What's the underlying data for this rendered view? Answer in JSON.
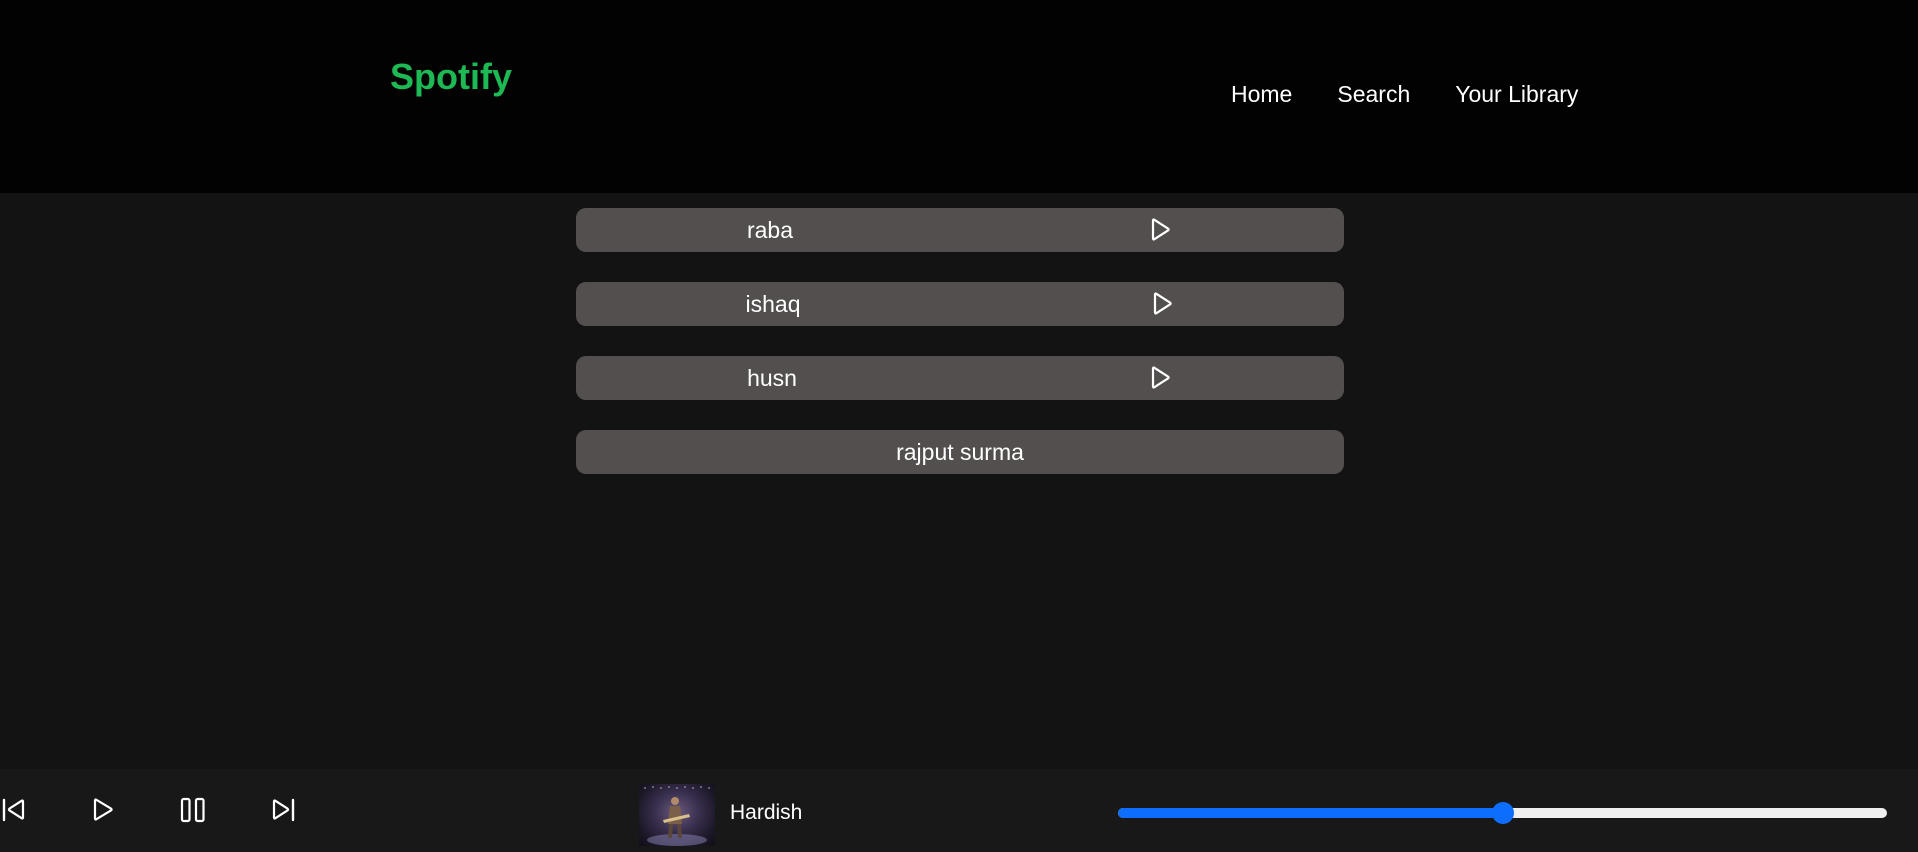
{
  "app": {
    "logo": "Spotify",
    "brand_color": "#1db954"
  },
  "nav": {
    "items": [
      {
        "label": "Home"
      },
      {
        "label": "Search"
      },
      {
        "label": "Your Library"
      }
    ]
  },
  "songs": [
    {
      "title": "raba",
      "has_play_icon": true
    },
    {
      "title": "ishaq",
      "has_play_icon": true
    },
    {
      "title": "husn",
      "has_play_icon": true
    },
    {
      "title": "rajput surma",
      "has_play_icon": false
    }
  ],
  "player": {
    "controls": [
      "previous-icon",
      "play-icon",
      "pause-icon",
      "next-icon"
    ],
    "track_name": "Hardish",
    "progress_fraction": 0.5,
    "progress_color": "#0d6efd"
  }
}
